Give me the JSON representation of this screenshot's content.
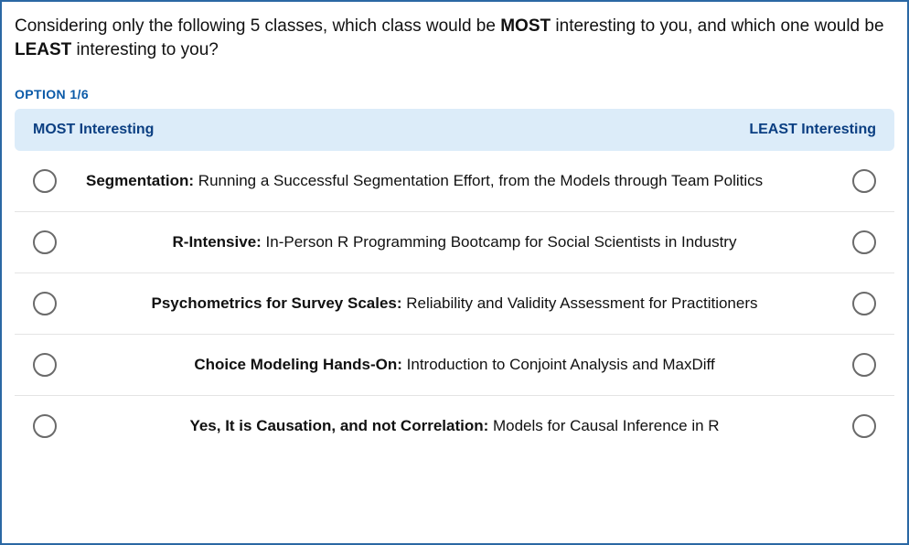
{
  "question_prefix": "Considering only the following 5 classes, which class would be ",
  "question_most": "MOST",
  "question_mid": " interesting to you, and which one would be ",
  "question_least": "LEAST",
  "question_suffix": " interesting to you?",
  "option_counter": "OPTION 1/6",
  "header_left": "MOST Interesting",
  "header_right": "LEAST Interesting",
  "rows": [
    {
      "bold": "Segmentation:",
      "rest": " Running a Successful Segmentation Effort, from the Models through Team Politics"
    },
    {
      "bold": "R-Intensive:",
      "rest": " In-Person R Programming Bootcamp for Social Scientists in Industry"
    },
    {
      "bold": "Psychometrics for Survey Scales:",
      "rest": " Reliability and Validity Assessment for Practitioners"
    },
    {
      "bold": "Choice Modeling Hands-On:",
      "rest": " Introduction to Conjoint Analysis and MaxDiff"
    },
    {
      "bold": "Yes, It is Causation, and not Correlation:",
      "rest": " Models for Causal Inference in R"
    }
  ]
}
